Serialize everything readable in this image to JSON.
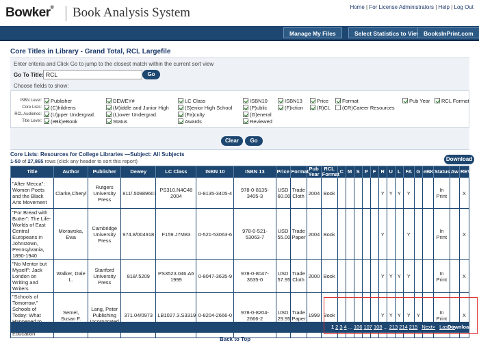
{
  "header": {
    "logo": "Bowker",
    "title": "Book Analysis System",
    "links": [
      "Home",
      "For License Administrators",
      "Help",
      "Log Out"
    ]
  },
  "nav": {
    "buttons": [
      "Manage My Files",
      "Select Statistics to View",
      "BooksInPrint.com"
    ]
  },
  "section_title": "Core Titles in Library - Grand Total, RCL Largefile",
  "filter": {
    "hint": "Enter criteria and Click Go to jump to the closest match within the current sort view",
    "goto_label": "Go To Title:",
    "goto_value": "RCL",
    "go_label": "Go",
    "fields_label": "Choose fields to show:",
    "row_labels": [
      "ISBN Level:",
      "Core Lists:",
      "RCL Audience:",
      "Title Level:"
    ],
    "checkboxes": [
      {
        "label": "Publisher",
        "checked": true
      },
      {
        "label": "(C)hildrens",
        "checked": true
      },
      {
        "label": "(U)pper Undergrad.",
        "checked": true
      },
      {
        "label": "(eBk)eBook",
        "checked": true
      },
      {
        "label": "DEWEY#",
        "checked": true
      },
      {
        "label": "(M)iddle and Junior High",
        "checked": true
      },
      {
        "label": "(L)ower Undergrad.",
        "checked": true
      },
      {
        "label": "Status",
        "checked": true
      },
      {
        "label": "LC Class",
        "checked": true
      },
      {
        "label": "(S)enior High School",
        "checked": true
      },
      {
        "label": "(Fa)culty",
        "checked": true
      },
      {
        "label": "Awards",
        "checked": true
      },
      {
        "label": "ISBN10",
        "checked": true
      },
      {
        "label": "(P)ublic",
        "checked": true
      },
      {
        "label": "(G)eneral",
        "checked": true
      },
      {
        "label": "Reviewed",
        "checked": true
      },
      {
        "label": "ISBN13",
        "checked": true
      },
      {
        "label": "(F)iction",
        "checked": true
      },
      {
        "label": "Price",
        "checked": true
      },
      {
        "label": "(R)CL",
        "checked": true
      },
      {
        "label": "Format",
        "checked": true
      },
      {
        "label": "(CR)Career Resources",
        "checked": false
      },
      {
        "label": "Pub Year",
        "checked": true
      },
      {
        "label": "RCL Format",
        "checked": true
      }
    ],
    "clear_label": "Clear",
    "go2_label": "Go"
  },
  "results": {
    "title": "Core Lists: Resources for College Libraries —Subject: All Subjects",
    "range": "1-50",
    "of": "of",
    "total": "27,865",
    "rows_text": "rows (click any header to sort this report)",
    "download_label": "Download",
    "columns": [
      "Title",
      "Author",
      "Publisher",
      "Dewey",
      "LC Class",
      "ISBN 10",
      "ISBN 13",
      "Price",
      "Format",
      "Pub Year",
      "RCL Format",
      "C",
      "M",
      "S",
      "P",
      "F",
      "R",
      "U",
      "L",
      "FA",
      "G",
      "eBK",
      "Status",
      "Aw",
      "REV"
    ],
    "rows": [
      {
        "title": "\"After Mecca\": Women Poets and the Black Arts Movement",
        "author": "Clarke,Cheryl",
        "publisher": "Rutgers University Press",
        "dewey": "811/.509896073",
        "lc": "PS310.N4C48 2004",
        "isbn10": "0-8135-3405-4",
        "isbn13": "978-0-8135-3405-3",
        "price": "USD 60.00",
        "format": "Trade Cloth",
        "year": "2004",
        "rclformat": "Book",
        "flags": [
          "",
          "",
          "",
          "",
          "",
          "Y",
          "Y",
          "Y",
          "Y",
          "",
          ""
        ],
        "status": "In Print",
        "aw": "",
        "rev": "X"
      },
      {
        "title": "\"For Bread with Butter\": The Life-Worlds of East Central Europeans in Johnstown, Pennsylvania, 1890-1940",
        "author": "Morawska, Ewa",
        "publisher": "Cambridge University Press",
        "dewey": "974.8/004918",
        "lc": "F159.J7M83",
        "isbn10": "0-521-53063-6",
        "isbn13": "978-0-521-53063-7",
        "price": "USD 55.00",
        "format": "Trade Paper",
        "year": "2004",
        "rclformat": "Book",
        "flags": [
          "",
          "",
          "",
          "",
          "",
          "Y",
          "",
          "",
          "Y",
          "",
          ""
        ],
        "status": "In Print",
        "aw": "",
        "rev": "X"
      },
      {
        "title": "\"No Mentor but Myself\": Jack London on Writing and Writers",
        "author": "Walker, Dale L.",
        "publisher": "Stanford University Press",
        "dewey": "818/.5209",
        "lc": "PS3523.046.A6 1999",
        "isbn10": "0-8047-3635-9",
        "isbn13": "978-0-8047-3635-0",
        "price": "USD 57.95",
        "format": "Trade Cloth",
        "year": "2000",
        "rclformat": "Book",
        "flags": [
          "",
          "",
          "",
          "",
          "",
          "Y",
          "Y",
          "Y",
          "Y",
          "",
          ""
        ],
        "status": "In Print",
        "aw": "",
        "rev": "X"
      },
      {
        "title": "\"Schools of Tomorrow,\" Schools of Today: What Happened to Progressive Education",
        "author": "Semel, Susan F.",
        "publisher": "Lang, Peter Publishing Incorporated",
        "dewey": "371.04/0973",
        "lc": "LB1027.3.S331999",
        "isbn10": "0-8204-2666-0",
        "isbn13": "978-0-8204-2666-2",
        "price": "USD 29.95",
        "format": "Trade Paper",
        "year": "1999",
        "rclformat": "Book",
        "flags": [
          "",
          "",
          "",
          "",
          "",
          "Y",
          "Y",
          "Y",
          "Y",
          "Y",
          ""
        ],
        "status": "In Print",
        "aw": "",
        "rev": "X"
      }
    ]
  },
  "pager": {
    "pages": [
      "1",
      "2",
      "3",
      "4",
      "...",
      "106",
      "107",
      "108",
      "...",
      "213",
      "214",
      "215"
    ],
    "next": "Next>",
    "last": "Last>>",
    "download": "Download"
  },
  "back_to_top": "Back to Top"
}
